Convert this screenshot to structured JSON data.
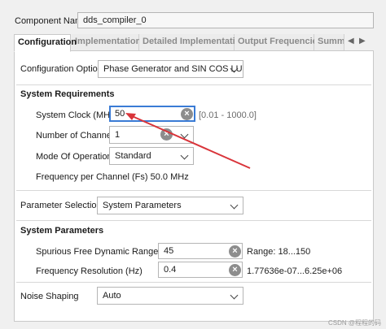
{
  "component": {
    "label": "Component Name",
    "value": "dds_compiler_0"
  },
  "tabs": [
    {
      "label": "Configuration"
    },
    {
      "label": "Implementation"
    },
    {
      "label": "Detailed Implementation"
    },
    {
      "label": "Output Frequencies"
    },
    {
      "label": "Summ"
    }
  ],
  "config_options": {
    "label": "Configuration Options",
    "value": "Phase Generator and SIN COS LUT"
  },
  "system_requirements": {
    "heading": "System Requirements",
    "clock": {
      "label": "System Clock (MHz)",
      "value": "50",
      "range": "[0.01 - 1000.0]"
    },
    "channels": {
      "label": "Number of Channels",
      "value": "1"
    },
    "mode": {
      "label": "Mode Of Operation",
      "value": "Standard"
    },
    "fs_text": "Frequency per Channel (Fs) 50.0 MHz"
  },
  "parameter_selection": {
    "label": "Parameter Selection",
    "value": "System Parameters"
  },
  "system_parameters": {
    "heading": "System Parameters",
    "sfdr": {
      "label": "Spurious Free Dynamic Range (dB)",
      "value": "45",
      "range": "Range: 18...150"
    },
    "freq_res": {
      "label": "Frequency Resolution (Hz)",
      "value": "0.4",
      "range": "1.77636e-07...6.25e+06"
    }
  },
  "noise_shaping": {
    "label": "Noise Shaping",
    "value": "Auto"
  },
  "watermark": "CSDN @程程的码",
  "colors": {
    "accent": "#3a7bd5",
    "annotation_arrow": "#d9343a"
  }
}
